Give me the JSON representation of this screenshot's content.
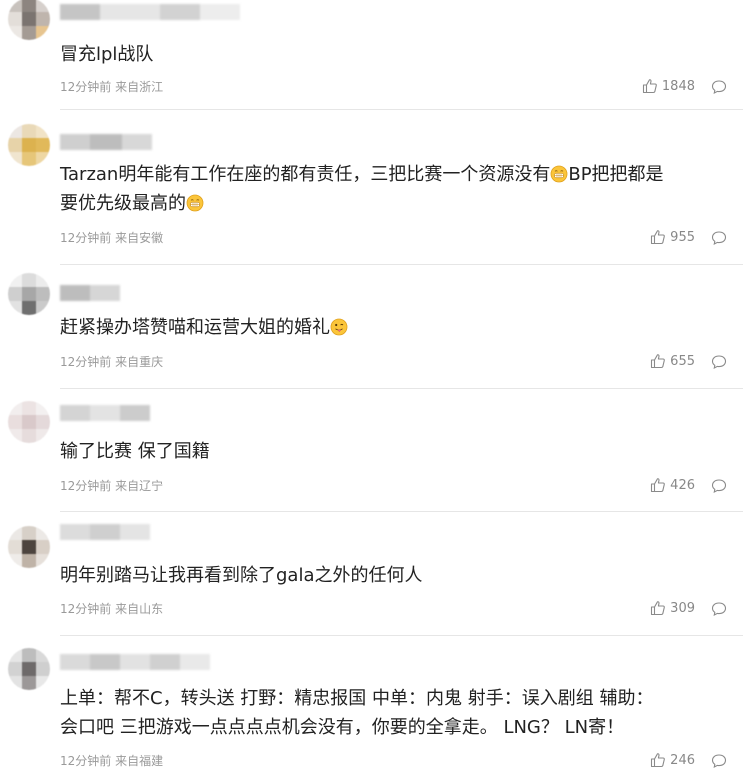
{
  "comments": [
    {
      "text": "冒充lpl战队",
      "time": "12分钟前",
      "location": "来自浙江",
      "likes": "1848"
    },
    {
      "text_a": "Tarzan明年能有工作在座的都有责任，三把比赛一个资源没有",
      "text_b": "BP把把都是",
      "text_c": "要优先级最高的",
      "time": "12分钟前",
      "location": "来自安徽",
      "likes": "955"
    },
    {
      "text": "赶紧操办塔赞喵和运营大姐的婚礼",
      "time": "12分钟前",
      "location": "来自重庆",
      "likes": "655"
    },
    {
      "text": "输了比赛 保了国籍",
      "time": "12分钟前",
      "location": "来自辽宁",
      "likes": "426"
    },
    {
      "text": "明年别踏马让我再看到除了gala之外的任何人",
      "time": "12分钟前",
      "location": "来自山东",
      "likes": "309"
    },
    {
      "line1": "上单：帮不C，转头送 打野：精忠报国 中单：内鬼 射手：误入剧组 辅助：",
      "line2": "会口吧 三把游戏一点点点点机会没有，你要的全拿走。 LNG？ LN寄！",
      "time": "12分钟前",
      "location": "来自福建",
      "likes": "246"
    }
  ],
  "icons": {
    "like": "thumbs-up-icon",
    "reply": "speech-bubble-icon",
    "emoji_grin": "grinning-emoji-icon",
    "emoji_wink": "tongue-wink-emoji-icon"
  }
}
